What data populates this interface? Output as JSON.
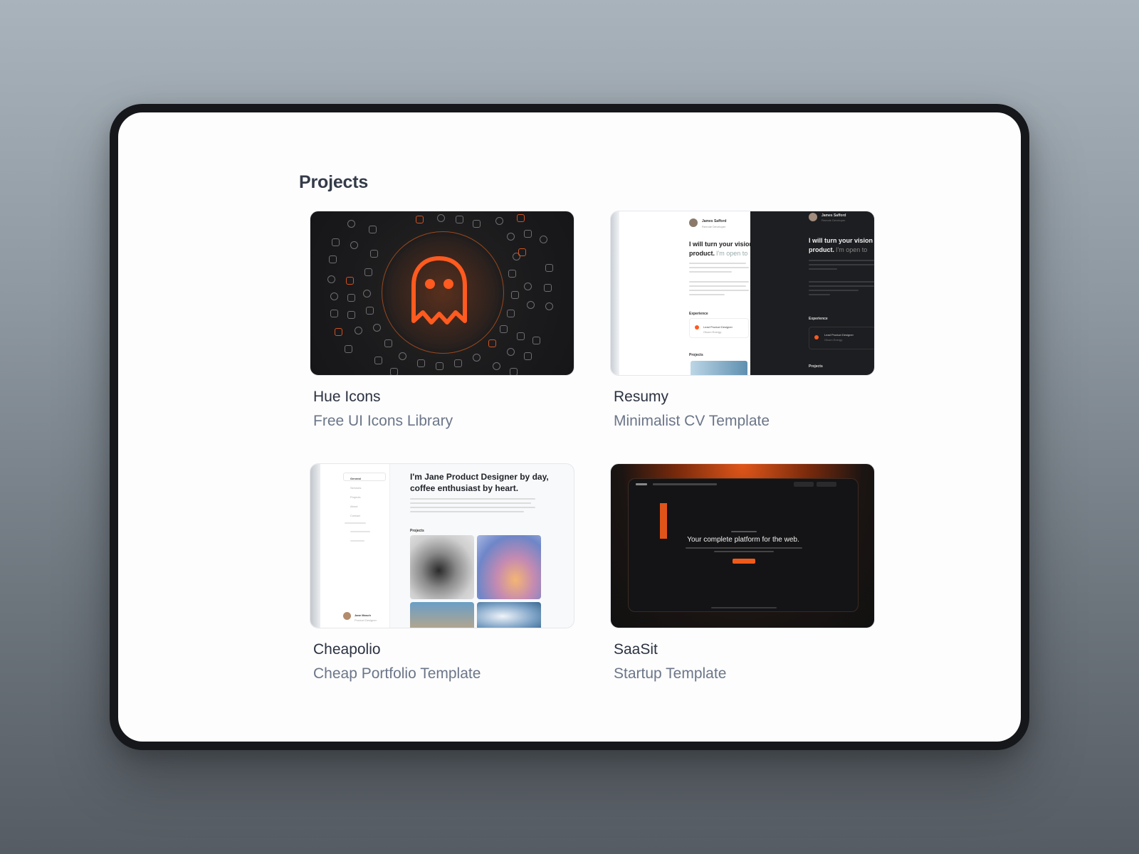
{
  "page": {
    "title": "Projects"
  },
  "projects": [
    {
      "title": "Hue Icons",
      "subtitle": "Free UI Icons Library"
    },
    {
      "title": "Resumy",
      "subtitle": "Minimalist CV Template",
      "preview": {
        "name": "James Safford",
        "role": "Remote Developer",
        "headline_a": "I will turn your vision",
        "headline_b": "product.",
        "headline_c": "I'm open to",
        "experience": "Experience",
        "job": "Lead Product Designer",
        "company": "Olcum Energy",
        "projects": "Projects"
      }
    },
    {
      "title": "Cheapolio",
      "subtitle": "Cheap Portfolio Template",
      "preview": {
        "headline": "I'm Jane Product Designer by day, coffee enthusiast by heart.",
        "projects": "Projects",
        "nav": [
          "General",
          "Services",
          "Projects",
          "About",
          "Contact"
        ],
        "user": "Jane Mosch",
        "user_role": "Product Designer"
      }
    },
    {
      "title": "SaaSit",
      "subtitle": "Startup Template",
      "preview": {
        "hero": "Your complete platform for the web."
      }
    }
  ],
  "colors": {
    "accent": "#ff5a1f",
    "text": "#2b3240",
    "muted": "#6b7688"
  }
}
